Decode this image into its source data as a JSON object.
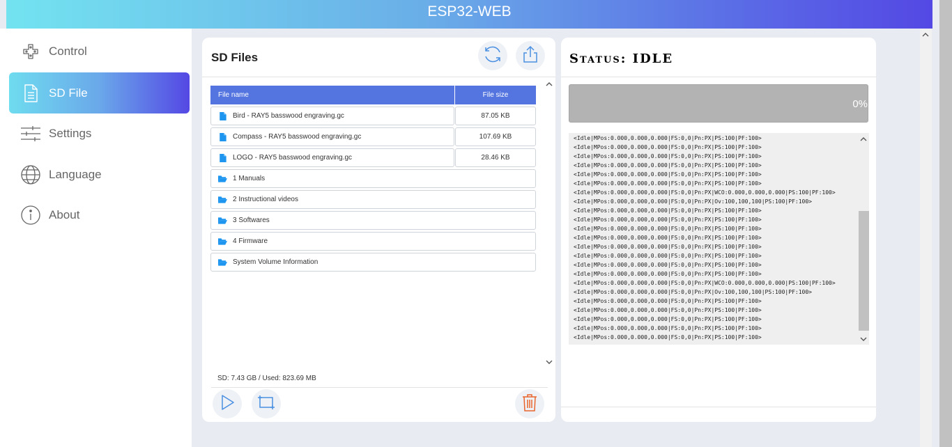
{
  "app": {
    "title": "ESP32-WEB"
  },
  "sidebar": {
    "items": [
      {
        "label": "Control",
        "icon": "gamepad-icon",
        "active": false
      },
      {
        "label": "SD File",
        "icon": "file-icon",
        "active": true
      },
      {
        "label": "Settings",
        "icon": "sliders-icon",
        "active": false
      },
      {
        "label": "Language",
        "icon": "globe-icon",
        "active": false
      },
      {
        "label": "About",
        "icon": "info-icon",
        "active": false
      }
    ]
  },
  "files": {
    "title": "SD Files",
    "columns": {
      "name": "File name",
      "size": "File size"
    },
    "entries": [
      {
        "type": "file",
        "name": "Bird - RAY5 basswood engraving.gc",
        "size": "87.05 KB"
      },
      {
        "type": "file",
        "name": "Compass - RAY5 basswood engraving.gc",
        "size": "107.69 KB"
      },
      {
        "type": "file",
        "name": "LOGO - RAY5 basswood engraving.gc",
        "size": "28.46 KB"
      },
      {
        "type": "folder",
        "name": "1 Manuals"
      },
      {
        "type": "folder",
        "name": "2 Instructional videos"
      },
      {
        "type": "folder",
        "name": "3 Softwares"
      },
      {
        "type": "folder",
        "name": "4 Firmware"
      },
      {
        "type": "folder",
        "name": "System Volume Information"
      }
    ],
    "storage": "SD: 7.43 GB  /  Used: 823.69 MB"
  },
  "status": {
    "title": "Status: IDLE",
    "progress_percent": 0,
    "progress_label": "0%",
    "console": [
      "<Idle|MPos:0.000,0.000,0.000|FS:0,0|Pn:PX|PS:100|PF:100>",
      "<Idle|MPos:0.000,0.000,0.000|FS:0,0|Pn:PX|PS:100|PF:100>",
      "<Idle|MPos:0.000,0.000,0.000|FS:0,0|Pn:PX|PS:100|PF:100>",
      "<Idle|MPos:0.000,0.000,0.000|FS:0,0|Pn:PX|PS:100|PF:100>",
      "<Idle|MPos:0.000,0.000,0.000|FS:0,0|Pn:PX|PS:100|PF:100>",
      "<Idle|MPos:0.000,0.000,0.000|FS:0,0|Pn:PX|PS:100|PF:100>",
      "<Idle|MPos:0.000,0.000,0.000|FS:0,0|Pn:PX|WCO:0.000,0.000,0.000|PS:100|PF:100>",
      "<Idle|MPos:0.000,0.000,0.000|FS:0,0|Pn:PX|Ov:100,100,100|PS:100|PF:100>",
      "<Idle|MPos:0.000,0.000,0.000|FS:0,0|Pn:PX|PS:100|PF:100>",
      "<Idle|MPos:0.000,0.000,0.000|FS:0,0|Pn:PX|PS:100|PF:100>",
      "<Idle|MPos:0.000,0.000,0.000|FS:0,0|Pn:PX|PS:100|PF:100>",
      "<Idle|MPos:0.000,0.000,0.000|FS:0,0|Pn:PX|PS:100|PF:100>",
      "<Idle|MPos:0.000,0.000,0.000|FS:0,0|Pn:PX|PS:100|PF:100>",
      "<Idle|MPos:0.000,0.000,0.000|FS:0,0|Pn:PX|PS:100|PF:100>",
      "<Idle|MPos:0.000,0.000,0.000|FS:0,0|Pn:PX|PS:100|PF:100>",
      "<Idle|MPos:0.000,0.000,0.000|FS:0,0|Pn:PX|PS:100|PF:100>",
      "<Idle|MPos:0.000,0.000,0.000|FS:0,0|Pn:PX|WCO:0.000,0.000,0.000|PS:100|PF:100>",
      "<Idle|MPos:0.000,0.000,0.000|FS:0,0|Pn:PX|Ov:100,100,100|PS:100|PF:100>",
      "<Idle|MPos:0.000,0.000,0.000|FS:0,0|Pn:PX|PS:100|PF:100>",
      "<Idle|MPos:0.000,0.000,0.000|FS:0,0|Pn:PX|PS:100|PF:100>",
      "<Idle|MPos:0.000,0.000,0.000|FS:0,0|Pn:PX|PS:100|PF:100>",
      "<Idle|MPos:0.000,0.000,0.000|FS:0,0|Pn:PX|PS:100|PF:100>",
      "<Idle|MPos:0.000,0.000,0.000|FS:0,0|Pn:PX|PS:100|PF:100>"
    ]
  },
  "colors": {
    "accent": "#5475e0",
    "delete": "#e8642c",
    "icon_blue": "#4a90e2"
  }
}
